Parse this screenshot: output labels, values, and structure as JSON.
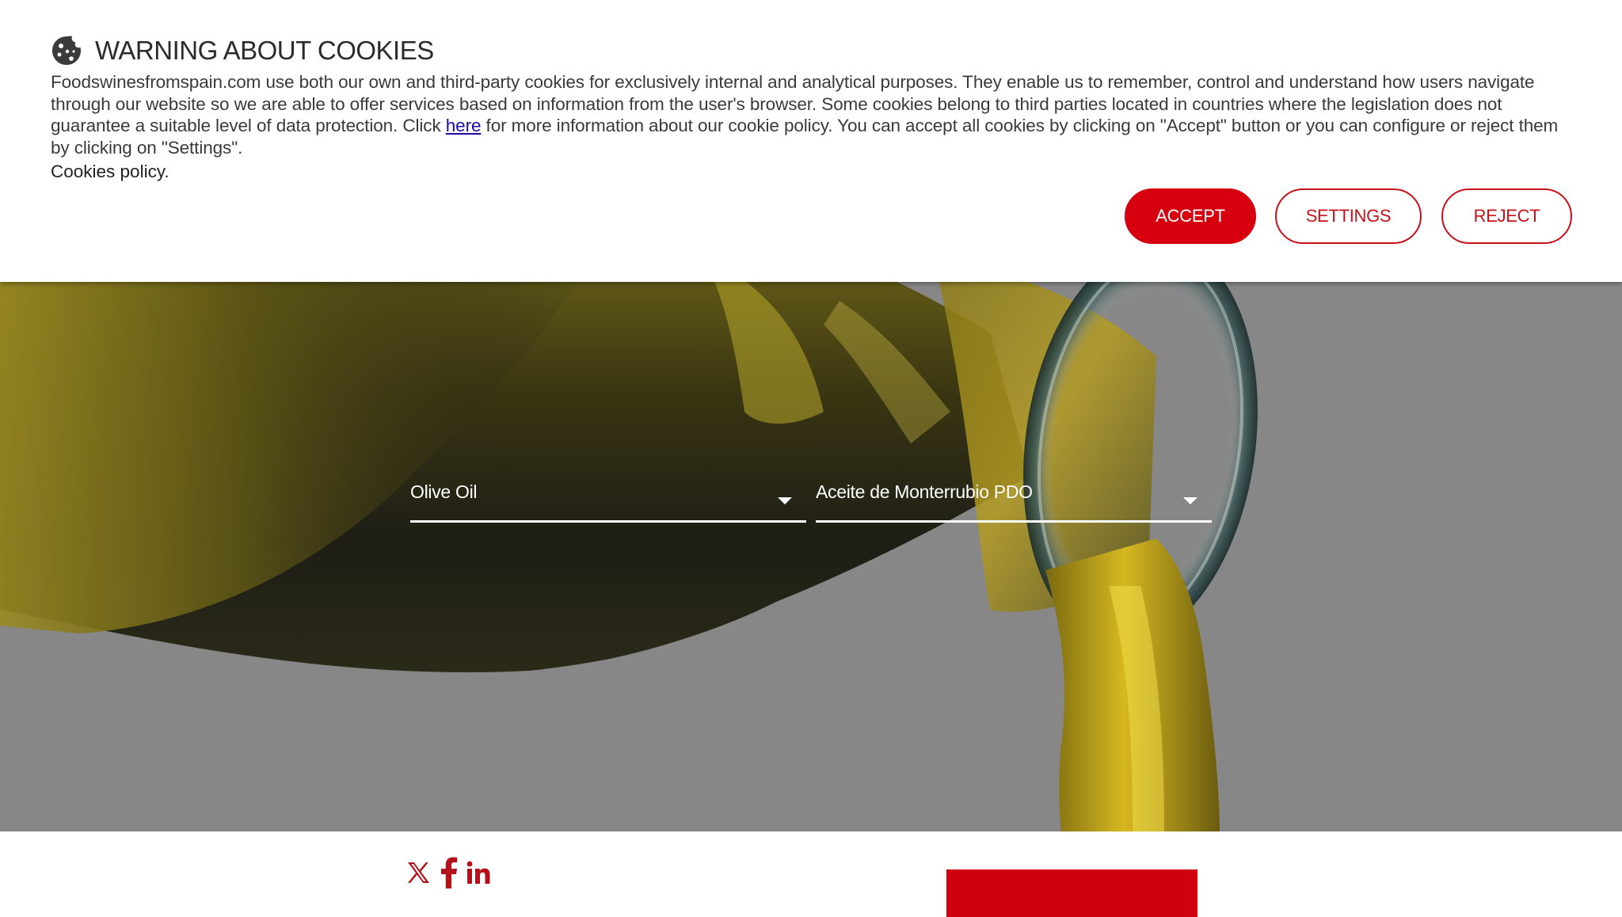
{
  "cookie_banner": {
    "title": "WARNING ABOUT COOKIES",
    "body_before_link": "Foodswinesfromspain.com use both our own and third-party cookies for exclusively internal and analytical purposes. They enable us to remember, control and understand how users navigate through our website so we are able to offer services based on information from the user's browser. Some cookies belong to third parties located in countries where the legislation does not guarantee a suitable level of data protection. Click ",
    "link_text": "here",
    "body_after_link": " for more information about our cookie policy. You can accept all cookies by clicking on \"Accept\" button or you can configure or reject them by clicking on \"Settings\".",
    "policy_link": "Cookies policy",
    "policy_suffix": ".",
    "accept_label": "ACCEPT",
    "settings_label": "SETTINGS",
    "reject_label": "REJECT",
    "accent_color": "#d6000f"
  },
  "filters": {
    "product": {
      "selected": "Olive Oil"
    },
    "pdo": {
      "selected": "Aceite de Monterrubio PDO"
    }
  },
  "footer": {
    "social_icons": [
      "x-icon",
      "facebook-icon",
      "linkedin-icon"
    ],
    "icon_color": "#b3121b"
  }
}
